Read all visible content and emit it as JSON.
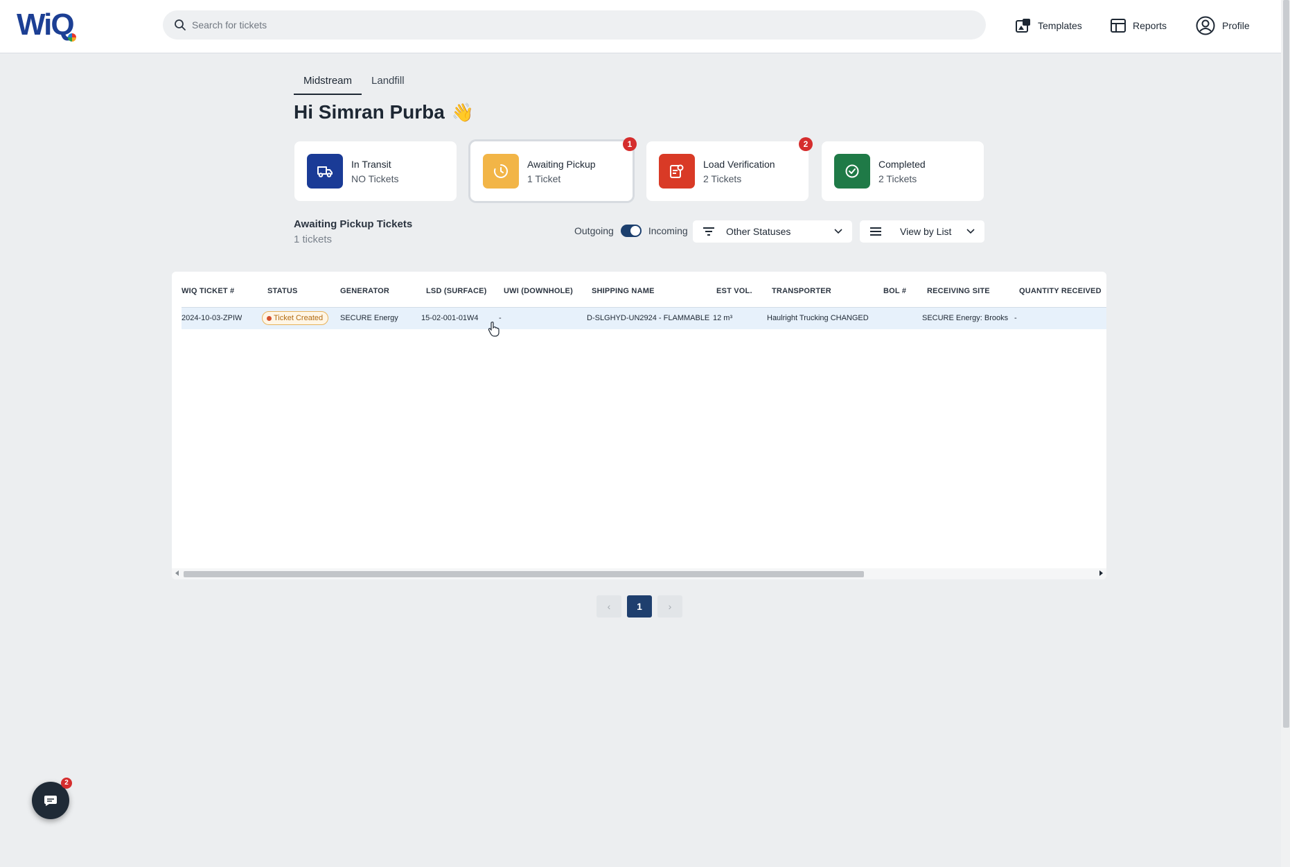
{
  "header": {
    "search_placeholder": "Search for tickets",
    "nav": [
      {
        "label": "Templates",
        "icon": "templates-icon"
      },
      {
        "label": "Reports",
        "icon": "reports-icon"
      },
      {
        "label": "Profile",
        "icon": "profile-icon"
      }
    ]
  },
  "tabs": [
    {
      "label": "Midstream",
      "active": true
    },
    {
      "label": "Landfill",
      "active": false
    }
  ],
  "greeting": "Hi Simran Purba",
  "greeting_emoji": "👋",
  "cards": [
    {
      "title": "In Transit",
      "sub": "NO Tickets",
      "color": "#1a3b96",
      "icon": "truck-icon",
      "badge": null
    },
    {
      "title": "Awaiting Pickup",
      "sub": "1 Ticket",
      "color": "#f2b547",
      "icon": "clock-icon",
      "badge": "1"
    },
    {
      "title": "Load Verification",
      "sub": "2 Tickets",
      "color": "#d93a26",
      "icon": "verification-icon",
      "badge": "2"
    },
    {
      "title": "Completed",
      "sub": "2 Tickets",
      "color": "#1f7a47",
      "icon": "check-circle-icon",
      "badge": null
    }
  ],
  "section": {
    "title": "Awaiting Pickup Tickets",
    "count": "1 tickets",
    "toggle_left": "Outgoing",
    "toggle_right": "Incoming",
    "status_filter": "Other Statuses",
    "view_mode": "View by List"
  },
  "table": {
    "columns": [
      "WIQ TICKET #",
      "STATUS",
      "GENERATOR",
      "LSD (SURFACE)",
      "UWI (DOWNHOLE)",
      "SHIPPING NAME",
      "EST VOL.",
      "TRANSPORTER",
      "BOL #",
      "RECEIVING SITE",
      "QUANTITY RECEIVED"
    ],
    "rows": [
      {
        "ticket": "2024-10-03-ZPIW",
        "status": "Ticket Created",
        "generator": "SECURE Energy",
        "lsd": "15-02-001-01W4",
        "uwi": "-",
        "shipping": "D-SLGHYD-UN2924 - FLAMMABLE",
        "est_vol": "12 m³",
        "transporter": "Haulright Trucking CHANGED",
        "bol": "",
        "receiving": "SECURE Energy: Brooks",
        "quantity": "-"
      }
    ]
  },
  "pagination": {
    "current": "1",
    "prev": "‹",
    "next": "›"
  },
  "chat": {
    "badge": "2"
  }
}
